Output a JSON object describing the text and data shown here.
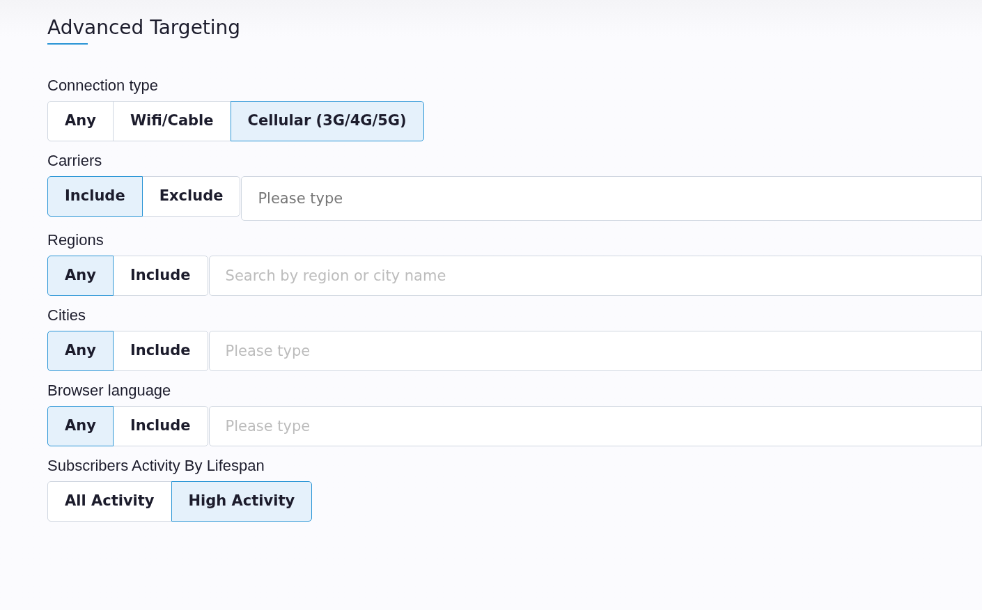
{
  "title": "Advanced Targeting",
  "groups": [
    {
      "label": "Connection type",
      "options": [
        {
          "label": "Any",
          "selected": false
        },
        {
          "label": "Wifi/Cable",
          "selected": false
        },
        {
          "label": "Cellular (3G/4G/5G)",
          "selected": true
        }
      ]
    },
    {
      "label": "Carriers",
      "options": [
        {
          "label": "Include",
          "selected": true
        },
        {
          "label": "Exclude",
          "selected": false
        }
      ],
      "field": {
        "placeholder": "Please type",
        "disabled": false
      }
    },
    {
      "label": "Regions",
      "options": [
        {
          "label": "Any",
          "selected": true
        },
        {
          "label": "Include",
          "selected": false
        }
      ],
      "field": {
        "placeholder": "Search by region or city name",
        "disabled": true
      }
    },
    {
      "label": "Cities",
      "options": [
        {
          "label": "Any",
          "selected": true
        },
        {
          "label": "Include",
          "selected": false
        }
      ],
      "field": {
        "placeholder": "Please type",
        "disabled": true
      }
    },
    {
      "label": "Browser language",
      "options": [
        {
          "label": "Any",
          "selected": true
        },
        {
          "label": "Include",
          "selected": false
        }
      ],
      "field": {
        "placeholder": "Please type",
        "disabled": true
      }
    },
    {
      "label": "Subscribers Activity By Lifespan",
      "options": [
        {
          "label": "All Activity",
          "selected": false
        },
        {
          "label": "High Activity",
          "selected": true
        }
      ]
    }
  ]
}
